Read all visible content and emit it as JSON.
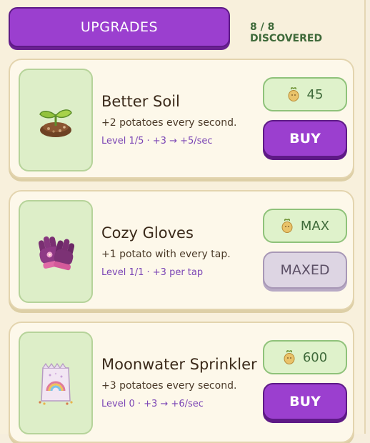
{
  "header": {
    "tab_label": "UPGRADES",
    "discovered": "8 / 8 DISCOVERED"
  },
  "upgrades": [
    {
      "name": "Better Soil",
      "description": "+2 potatoes every second.",
      "level_text": "Level 1/5 · +3 → +5/sec",
      "price": "45",
      "action": "BUY",
      "thumbnail_icon": "sprout-icon"
    },
    {
      "name": "Cozy Gloves",
      "description": "+1 potato with every tap.",
      "level_text": "Level 1/1 · +3 per tap",
      "price": "MAX",
      "action": "MAXED",
      "thumbnail_icon": "gloves-icon"
    },
    {
      "name": "Moonwater Sprinkler",
      "description": "+3 potatoes every second.",
      "level_text": "Level 0 · +3 → +6/sec",
      "price": "600",
      "action": "BUY",
      "thumbnail_icon": "seed-bag-icon"
    }
  ],
  "currency_icon": "potato-icon",
  "colors": {
    "accent_purple": "#9b3fcf",
    "price_green": "#3f6a3a",
    "thumb_green": "#ddeec8",
    "maxed_grey": "#ddd5e3"
  }
}
